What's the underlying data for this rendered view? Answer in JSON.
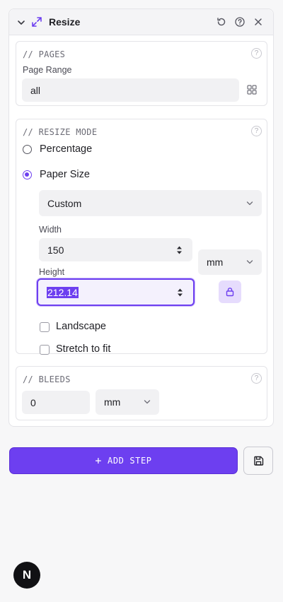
{
  "header": {
    "title": "Resize"
  },
  "pages": {
    "section_title": "// PAGES",
    "help_glyph": "?",
    "page_range_label": "Page Range",
    "page_range_value": "all"
  },
  "resize_mode": {
    "section_title": "// RESIZE MODE",
    "help_glyph": "?",
    "options": [
      {
        "label": "Percentage",
        "selected": false
      },
      {
        "label": "Paper Size",
        "selected": true
      }
    ],
    "paper_size_value": "Custom",
    "width_label": "Width",
    "width_value": "150",
    "height_label": "Height",
    "height_value": "212.14",
    "unit_value": "mm",
    "landscape_label": "Landscape",
    "stretch_label": "Stretch to fit"
  },
  "bleeds": {
    "section_title": "// BLEEDS",
    "help_glyph": "?",
    "value": "0",
    "unit_value": "mm"
  },
  "footer": {
    "add_step_label": "ADD STEP",
    "add_step_glyph": "+"
  },
  "avatar": {
    "letter": "N"
  },
  "colors": {
    "accent": "#6d3ff0",
    "accent_light": "#e6dcfd",
    "border": "#e4e4e8",
    "field_bg": "#f1f1f3"
  }
}
